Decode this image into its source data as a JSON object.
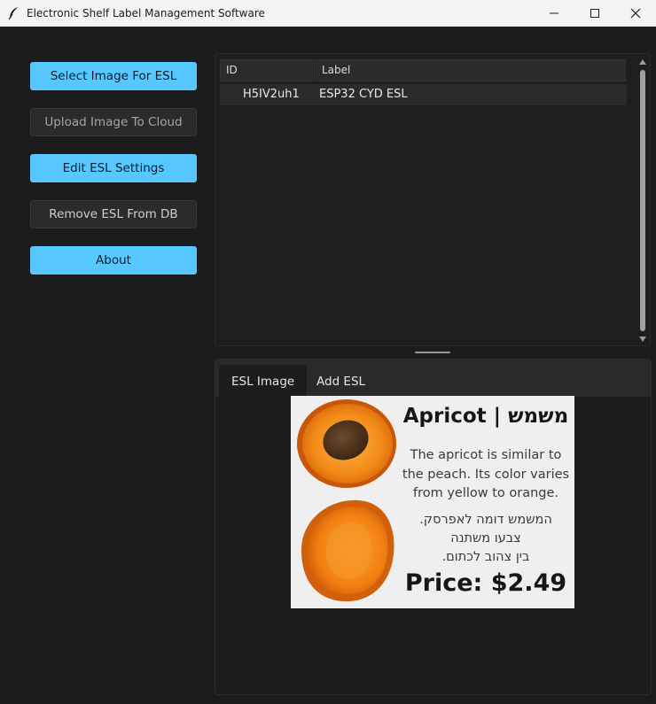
{
  "window": {
    "title": "Electronic Shelf Label Management Software"
  },
  "buttons": {
    "select_image": "Select Image For ESL",
    "upload_image": "Upload Image To Cloud",
    "edit_settings": "Edit ESL Settings",
    "remove_esl": "Remove ESL From DB",
    "about": "About"
  },
  "table": {
    "columns": [
      "ID",
      "Label"
    ],
    "rows": [
      {
        "id": "H5IV2uh1",
        "label": "ESP32 CYD ESL"
      }
    ]
  },
  "tabs": [
    "ESL Image",
    "Add ESL"
  ],
  "esl_image": {
    "product_name": "Apricot | משמש",
    "description_en": [
      "The apricot is similar to",
      "the peach. Its color varies",
      "from yellow to orange."
    ],
    "description_he": [
      "המשמש דומה לאפרסק.",
      "צבעו משתנה",
      "בין צהוב לכתום."
    ],
    "price": "Price: $2.49"
  },
  "colors": {
    "accent": "#57c8ff",
    "background": "#1c1c1c",
    "panel": "#2b2b2b"
  },
  "icons": {
    "app": "feather-icon",
    "minimize": "minimize-icon",
    "maximize": "maximize-icon",
    "close": "close-icon"
  }
}
